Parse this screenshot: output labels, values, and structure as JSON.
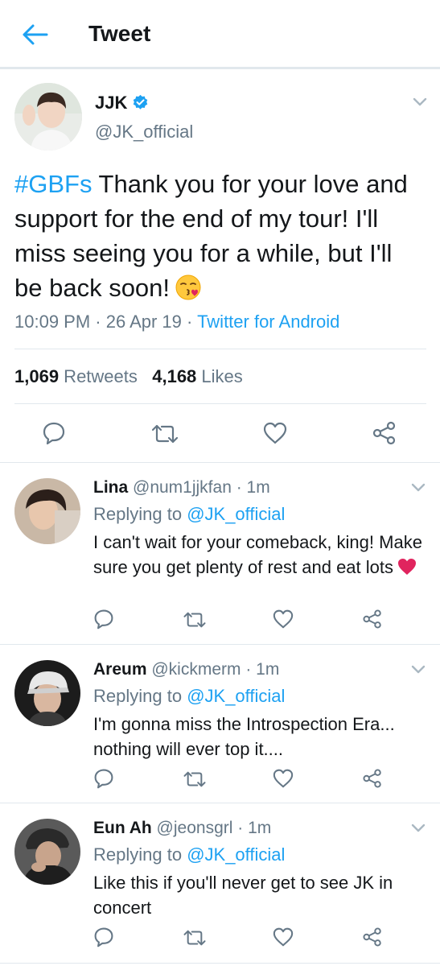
{
  "header": {
    "title": "Tweet"
  },
  "tweet": {
    "name": "JJK",
    "handle": "@JK_official",
    "hashtag": "#GBFs",
    "text": " Thank you for your love and support for the end of my tour! I'll miss seeing you for a while, but I'll be back soon!",
    "time": "10:09 PM · 26 Apr 19 · ",
    "source": "Twitter for Android",
    "retweets_count": "1,069",
    "retweets_label": " Retweets",
    "likes_count": "4,168",
    "likes_label": " Likes"
  },
  "replies": [
    {
      "name": "Lina",
      "meta": " @num1jjkfan · 1m",
      "replying_label": "Replying to ",
      "replying_to": "@JK_official",
      "text": "I can't wait for your comeback, king! Make sure you get plenty of rest and eat lots"
    },
    {
      "name": "Areum",
      "meta": " @kickmerm · 1m",
      "replying_label": "Replying to ",
      "replying_to": "@JK_official",
      "text": "I'm gonna miss the Introspection Era... nothing will ever top it...."
    },
    {
      "name": "Eun Ah",
      "meta": " @jeonsgrl · 1m",
      "replying_label": "Replying to ",
      "replying_to": "@JK_official",
      "text": "Like this if you'll never get to see JK in concert"
    }
  ],
  "colors": {
    "accent": "#1da1f2",
    "secondary": "#657786",
    "text": "#14171a",
    "divider": "#e1e8ed"
  },
  "icons": [
    "back-arrow-icon",
    "verified-badge-icon",
    "chevron-down-icon",
    "reply-icon",
    "retweet-icon",
    "like-icon",
    "share-icon",
    "kiss-emoji-icon",
    "heart-emoji-icon"
  ]
}
